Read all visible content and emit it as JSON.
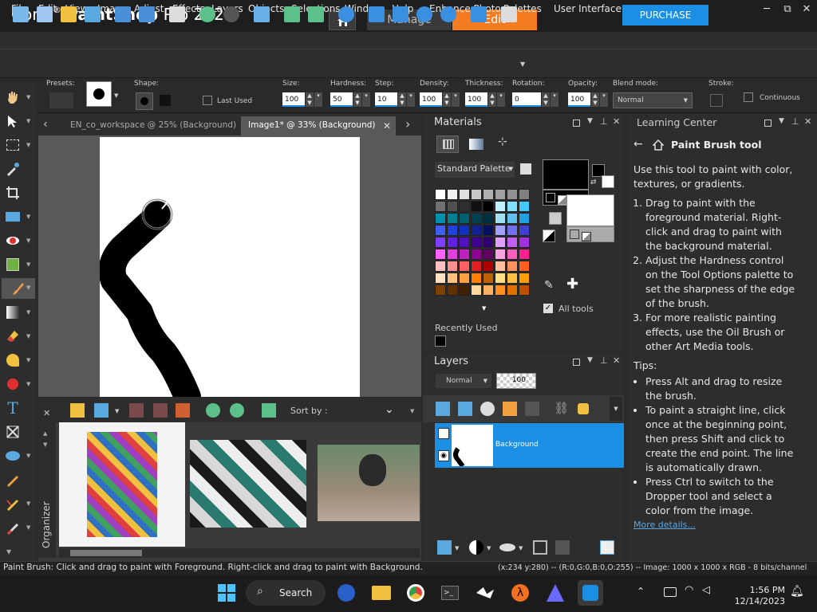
{
  "title": {
    "brand": "Corel",
    "reg": "®",
    "product": "PaintShop",
    "pro": "Pro 2023"
  },
  "workspace_tabs": {
    "manage": "Manage",
    "edit": "Edit"
  },
  "purchase_label": "PURCHASE",
  "window_controls": {
    "minimize": "─",
    "restore": "⧉",
    "close": "✕"
  },
  "menu": [
    "File",
    "Edit",
    "View",
    "Image",
    "Adjust",
    "Effects",
    "Layers",
    "Objects",
    "Selections",
    "Window",
    "Help",
    "Enhance Photo",
    "Palettes",
    "User Interface"
  ],
  "tool_options": {
    "presets": "Presets:",
    "shape": "Shape:",
    "last_used": "Last Used",
    "size_label": "Size:",
    "size": "100",
    "hardness_label": "Hardness:",
    "hardness": "50",
    "step_label": "Step:",
    "step": "10",
    "density_label": "Density:",
    "density": "100",
    "thickness_label": "Thickness:",
    "thickness": "100",
    "rotation_label": "Rotation:",
    "rotation": "0",
    "opacity_label": "Opacity:",
    "opacity": "100",
    "blend_label": "Blend mode:",
    "blend": "Normal",
    "stroke_label": "Stroke:",
    "continuous": "Continuous"
  },
  "doc_tabs": [
    {
      "label": "EN_co_workspace @  25% (Background)",
      "active": false
    },
    {
      "label": "Image1* @  33% (Background)",
      "active": true
    }
  ],
  "organizer": {
    "label": "Organizer",
    "sort_by": "Sort by :"
  },
  "materials": {
    "title": "Materials",
    "palette": "Standard Palette",
    "recently_used": "Recently Used",
    "all_tools": "All tools",
    "foreground": "#000000",
    "background": "#ffffff"
  },
  "swatches": [
    [
      "#ffffff",
      "#f0f0f0",
      "#e0e0e0",
      "#c8c8c8",
      "#b0b0b0",
      "#a0a0a0",
      "#909090",
      "#808080"
    ],
    [
      "#707070",
      "#505050",
      "#303030",
      "#101010",
      "#000000",
      "#c0f0ff",
      "#80e0ff",
      "#40c8ff"
    ],
    [
      "#0090b0",
      "#008090",
      "#006070",
      "#004050",
      "#003040",
      "#a0e0f0",
      "#60c0f0",
      "#20a0e0"
    ],
    [
      "#4060ff",
      "#2040e0",
      "#1030c0",
      "#102090",
      "#081060",
      "#a0a0ff",
      "#7070f0",
      "#4040d0"
    ],
    [
      "#8040ff",
      "#6020e0",
      "#5010c0",
      "#400090",
      "#300070",
      "#e0a0ff",
      "#c060f0",
      "#a030e0"
    ],
    [
      "#ff60ff",
      "#e040e0",
      "#c020c0",
      "#900090",
      "#600060",
      "#ffa0e0",
      "#ff60c0",
      "#ff2090"
    ],
    [
      "#ffc0c0",
      "#ff9090",
      "#ff6060",
      "#e02020",
      "#b00000",
      "#ffc0a0",
      "#ff9060",
      "#ff6020"
    ],
    [
      "#ffe0c0",
      "#ffc080",
      "#ffa040",
      "#ff8000",
      "#c06000",
      "#ffe080",
      "#ffc040",
      "#ffa000"
    ],
    [
      "#804000",
      "#603000",
      "#402000",
      "#ffd8a0",
      "#ffb060",
      "#ff9020",
      "#e07000",
      "#c05000"
    ]
  ],
  "layers": {
    "title": "Layers",
    "blend": "Normal",
    "opacity": "100",
    "background_layer": "Background"
  },
  "learning_center": {
    "title": "Learning Center",
    "heading": "Paint Brush tool",
    "intro": "Use this tool to paint with color, textures, or gradients.",
    "steps": [
      "Drag to paint with the foreground material. Right-click and drag to paint with the background material.",
      "Adjust the Hardness control on the Tool Options palette to set the sharpness of the edge of the brush.",
      "For more realistic painting effects, use the Oil Brush or other Art Media tools."
    ],
    "tips_label": "Tips:",
    "tips": [
      "Press Alt and drag to resize the brush.",
      "To paint a straight line, click once at the beginning point, then press Shift and click to create the end point. The line is automatically drawn.",
      "Press Ctrl to switch to the Dropper tool and select a color from the image."
    ],
    "more": "More details..."
  },
  "status": {
    "left": "Paint Brush: Click and drag to paint with Foreground. Right-click and drag to paint with Background.",
    "right": "(x:234 y:280) -- (R:0,G:0,B:0,O:255) -- Image:  1000 x 1000 x RGB - 8 bits/channel"
  },
  "taskbar": {
    "search": "Search",
    "time": "1:56 PM",
    "date": "12/14/2023"
  }
}
